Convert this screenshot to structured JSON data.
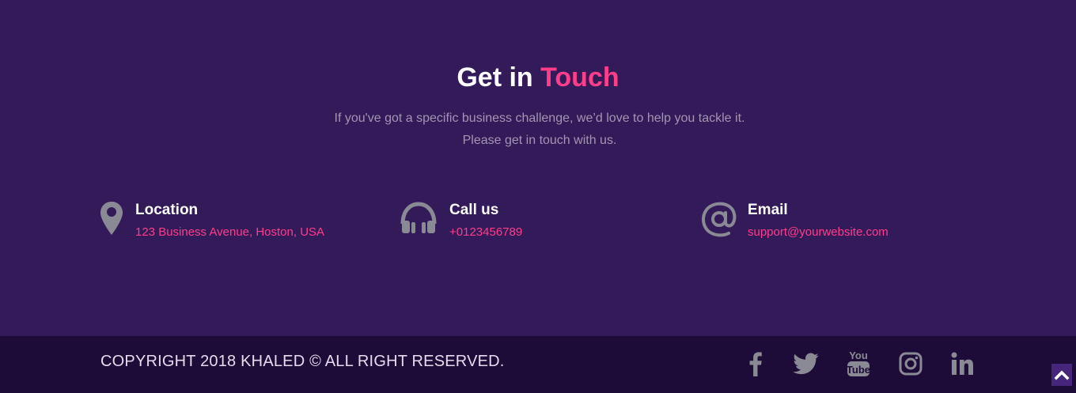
{
  "contact": {
    "heading_main": "Get in",
    "heading_accent": "Touch",
    "subtitle_line1": "If you've got a specific business challenge, we’d love to help you tackle it.",
    "subtitle_line2": "Please get in touch with us.",
    "items": [
      {
        "icon": "map-pin-icon",
        "title": "Location",
        "value": "123 Business Avenue, Hoston, USA"
      },
      {
        "icon": "headphones-icon",
        "title": "Call us",
        "value": "+0123456789"
      },
      {
        "icon": "at-sign-icon",
        "title": "Email",
        "value": "support@yourwebsite.com"
      }
    ]
  },
  "footer": {
    "copyright": "COPYRIGHT 2018 KHALED © ALL RIGHT RESERVED.",
    "social": [
      "facebook-icon",
      "twitter-icon",
      "youtube-icon",
      "instagram-icon",
      "linkedin-icon"
    ]
  },
  "colors": {
    "background": "#331a58",
    "footer_background": "#1e0c38",
    "accent": "#ff3d8b",
    "icon_gray": "#8a8a95"
  }
}
